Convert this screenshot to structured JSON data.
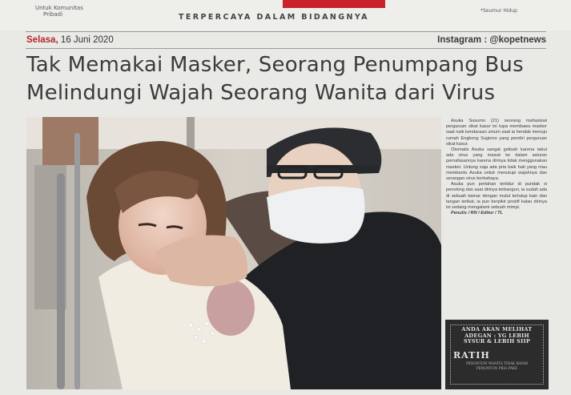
{
  "masthead": {
    "left_note": [
      "Untuk Komunitas",
      "Pribadi"
    ],
    "tagline": "TERPERCAYA DALAM BIDANGNYA",
    "right_note": "*Seumur Hidup",
    "accent_color": "#c8232b"
  },
  "dateline": {
    "day": "Selasa,",
    "date": "16 Juni 2020",
    "instagram": "Instagram : @kopetnews"
  },
  "headline": {
    "line1": "Tak Memakai Masker, Seorang Penumpang Bus",
    "line2": "Melindungi Wajah Seorang Wanita dari Virus"
  },
  "article": {
    "paragraphs": [
      "Asuka Susumo (21) seorang mahasiswi perguruan sikat kasur ini tupa membawa masker saat naik kendaraan umum saat ia hendak menuju rumah Engkong Sugiono yang pendiri perguruan sikat kasur.",
      "Otomatis Asuka sangat gelisah karena takut ada virus yang masuk ke dalam saluran pernafasannya karena dirinya tidak menggunakan masker. Untung saja ada pria baik hati yang mau membantu Asuka untuk menutupi wajahnya dan serangan virus berbahaya.",
      "Asuka pun perlahan tertidur di pundak si penolong dan saat dirinya terbangun, ia sudah ada di sebuah kamar dengan mulut tertutup kain dan tangan terikat, ia pun berpikir positif kalau dirinya ini sedang mengalami sebuah mimpi.",
      "Penulis / RN / Editor / TL"
    ]
  },
  "ad": {
    "line1": "ANDA AKAN MELIHAT",
    "line2": "ADEGAN : YG LEBIH",
    "line3": "SYSUR & LEBIH SIIP",
    "brand": "RATIH",
    "small1": "PENONTON WANITA TIDAK BAYAR",
    "small2": "PENONTON PRIA PAKE"
  }
}
